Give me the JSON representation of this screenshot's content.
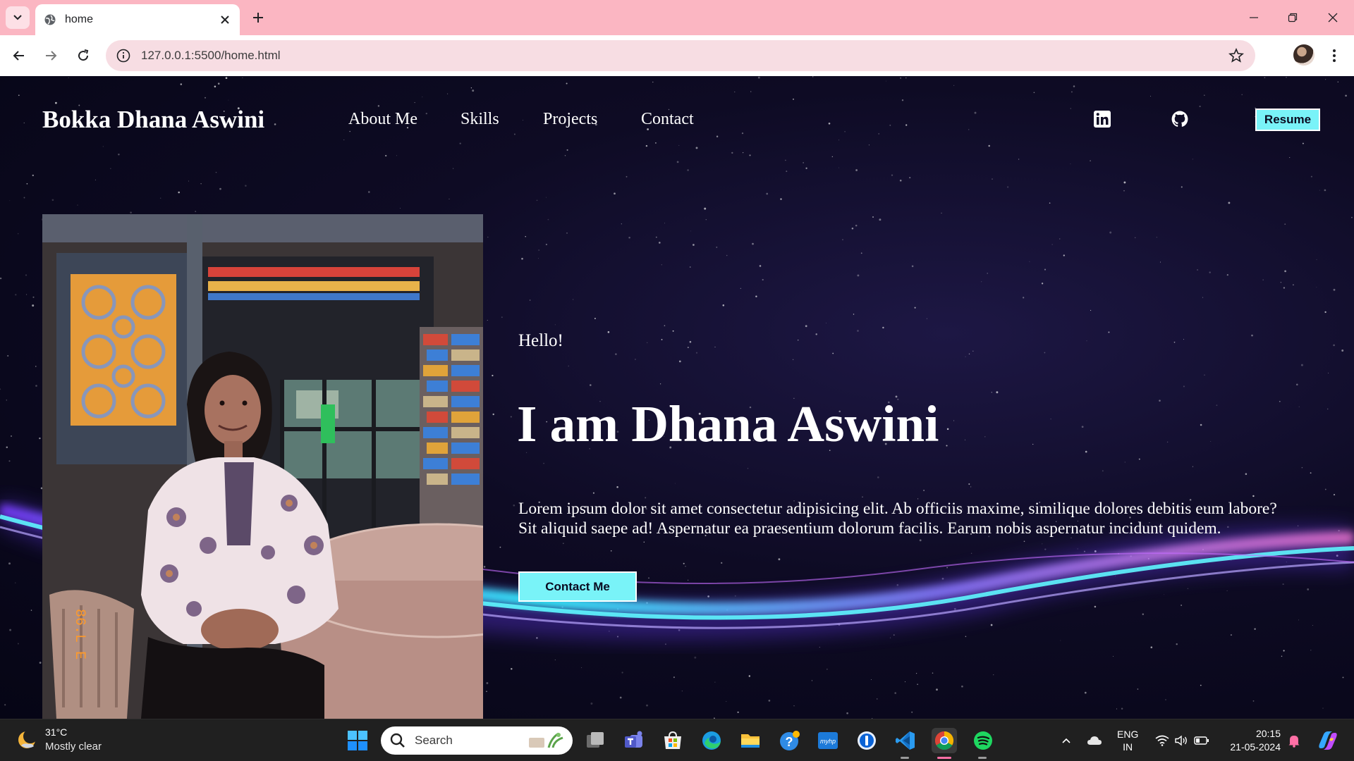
{
  "browser": {
    "tab_title": "home",
    "url": "127.0.0.1:5500/home.html",
    "icons": [
      "tab-search-icon",
      "globe-icon",
      "close-icon",
      "plus-icon",
      "minimize-icon",
      "restore-icon",
      "close-window-icon",
      "back-icon",
      "forward-icon",
      "reload-icon",
      "info-icon",
      "star-icon",
      "avatar",
      "more-icon"
    ]
  },
  "site": {
    "title": "Bokka Dhana Aswini",
    "nav": [
      "About Me",
      "Skills",
      "Projects",
      "Contact"
    ],
    "social_icons": [
      "linkedin-icon",
      "github-icon"
    ],
    "resume_label": "Resume",
    "greeting": "Hello!",
    "headline": "I am Dhana Aswini",
    "intro_line1": "Lorem ipsum dolor sit amet consectetur adipisicing elit. Ab officiis maxime, similique dolores debitis eum labore?",
    "intro_line2": "Sit aliquid saepe ad! Aspernatur ea praesentium dolorum facilis. Earum nobis aspernatur incidunt quidem.",
    "contact_label": "Contact Me",
    "accent_color": "#79f3f8",
    "photo_date": "86.L E"
  },
  "taskbar": {
    "weather_temp": "31°C",
    "weather_desc": "Mostly clear",
    "search_label": "Search",
    "lang_line1": "ENG",
    "lang_line2": "IN",
    "time": "20:15",
    "date": "21-05-2024"
  }
}
